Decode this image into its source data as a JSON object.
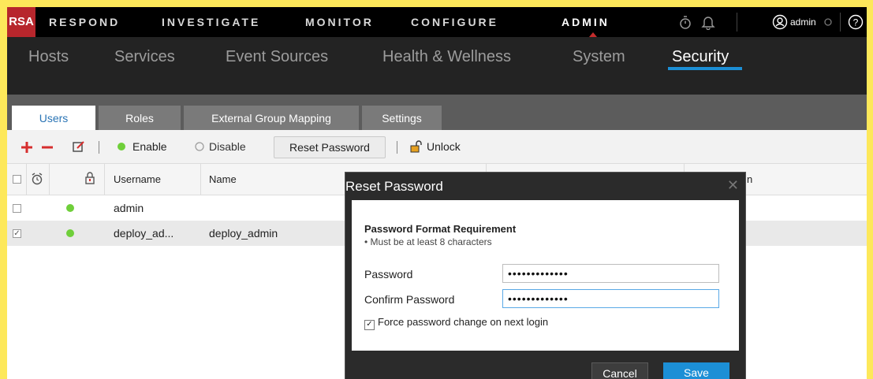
{
  "topnav": {
    "logo": "RSA",
    "items": [
      "RESPOND",
      "INVESTIGATE",
      "MONITOR",
      "CONFIGURE",
      "ADMIN"
    ],
    "active": "ADMIN",
    "user": "admin",
    "icons": [
      "timer-icon",
      "bell-icon",
      "user-icon",
      "help-icon"
    ]
  },
  "subnav": {
    "items": [
      "Hosts",
      "Services",
      "Event Sources",
      "Health & Wellness",
      "System",
      "Security"
    ],
    "active": "Security"
  },
  "tabs": {
    "items": [
      "Users",
      "Roles",
      "External Group Mapping",
      "Settings"
    ],
    "active": "Users"
  },
  "toolbar": {
    "enable": "Enable",
    "disable": "Disable",
    "reset_password": "Reset Password",
    "unlock": "Unlock"
  },
  "table": {
    "headers": [
      "Username",
      "Name"
    ],
    "partial_header": "n",
    "rows": [
      {
        "username": "admin",
        "name": "",
        "checked": false,
        "status": "enabled"
      },
      {
        "username": "deploy_ad...",
        "name": "deploy_admin",
        "checked": true,
        "status": "enabled"
      }
    ]
  },
  "dialog": {
    "title": "Reset Password",
    "requirement_title": "Password Format Requirement",
    "requirement": "• Must be at least 8 characters",
    "password_label": "Password",
    "password_value": "•••••••••••••",
    "confirm_label": "Confirm Password",
    "confirm_value": "•••••••••••••",
    "force_label": "Force password change on next login",
    "force_checked": true,
    "cancel": "Cancel",
    "save": "Save"
  },
  "colors": {
    "accent": "#1c8fd6",
    "brand": "#b7262c",
    "status_enabled": "#6fcf3a"
  }
}
